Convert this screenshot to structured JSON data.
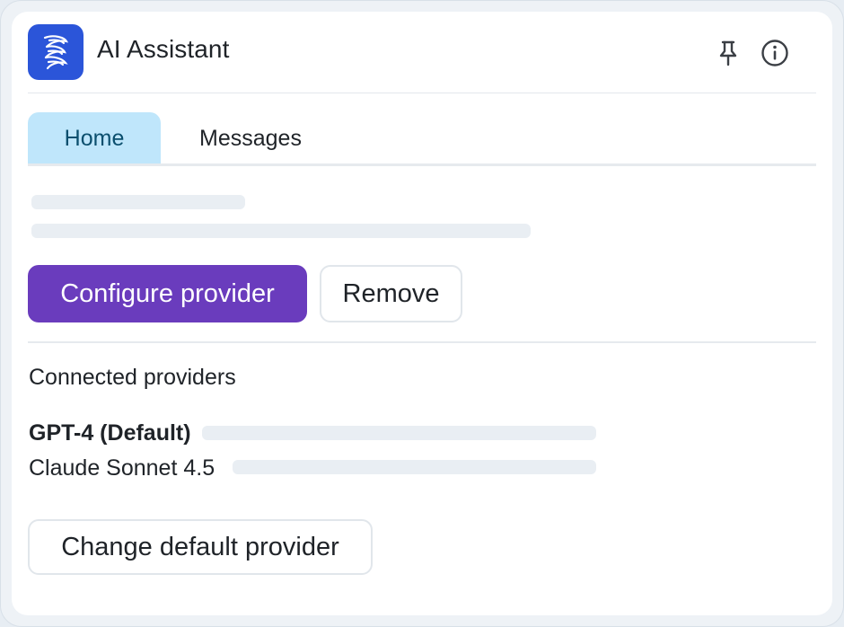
{
  "app": {
    "title": "AI Assistant",
    "logo_icon": "wave-stripes-icon",
    "accent_color": "#2b55d9"
  },
  "header": {
    "pin_icon": "pin-icon",
    "info_icon": "info-icon"
  },
  "tabs": [
    {
      "label": "Home",
      "active": true
    },
    {
      "label": "Messages",
      "active": false
    }
  ],
  "actions": {
    "configure_label": "Configure provider",
    "remove_label": "Remove",
    "primary_color": "#6a3cbd"
  },
  "providers": {
    "section_title": "Connected providers",
    "items": [
      {
        "label": "GPT-4 (Default)",
        "is_default": true
      },
      {
        "label": "Claude Sonnet 4.5",
        "is_default": false
      }
    ],
    "change_default_label": "Change default provider"
  }
}
